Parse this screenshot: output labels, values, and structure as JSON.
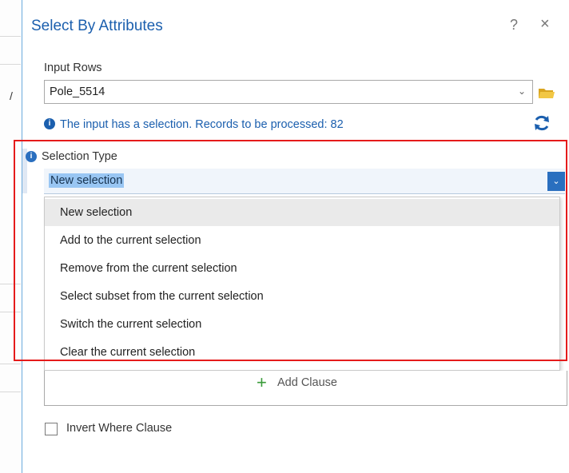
{
  "dialog": {
    "title": "Select By Attributes",
    "help_glyph": "?",
    "close_glyph": "×"
  },
  "input_rows": {
    "label": "Input Rows",
    "value": "Pole_5514",
    "info_message": "The input has a selection. Records to be processed: 82"
  },
  "selection_type": {
    "label": "Selection Type",
    "selected": "New selection",
    "options": [
      "New selection",
      "Add to the current selection",
      "Remove from the current selection",
      "Select subset from the current selection",
      "Switch the current selection",
      "Clear the current selection"
    ]
  },
  "clause": {
    "add_label": "Add Clause"
  },
  "invert": {
    "label": "Invert Where Clause",
    "checked": false
  },
  "colors": {
    "accent": "#1b5fae",
    "highlight": "#e51b1b",
    "add_green": "#3a9b3a"
  },
  "icons": [
    "help-icon",
    "close-icon",
    "chevron-down-icon",
    "folder-icon",
    "info-icon",
    "refresh-icon",
    "plus-icon"
  ]
}
